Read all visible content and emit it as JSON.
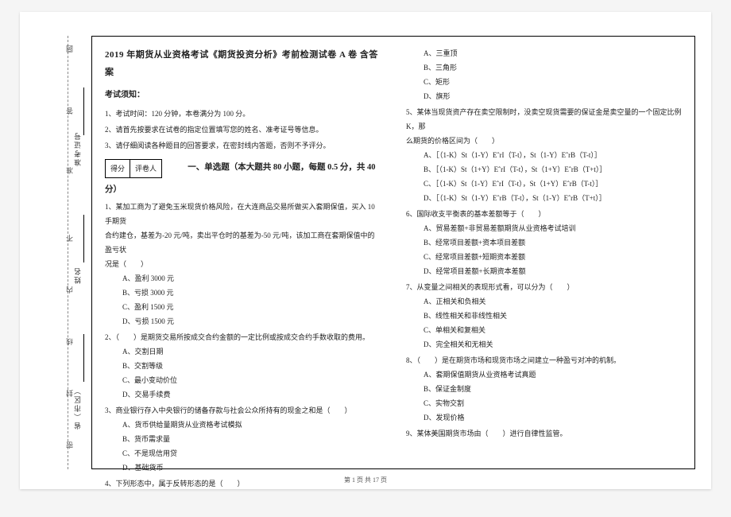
{
  "doc": {
    "title": "2019 年期货从业资格考试《期货投资分析》考前检测试卷 A 卷  含答案",
    "notice_head": "考试须知：",
    "instructions": [
      "1、考试时间：120 分钟，本卷满分为 100 分。",
      "2、请首先按要求在试卷的指定位置填写您的姓名、准考证号等信息。",
      "3、请仔细阅读各种题目的回答要求，在密封线内答题，否则不予评分。"
    ],
    "score_labels": {
      "a": "得分",
      "b": "评卷人"
    },
    "section1_title": "一、单选题（本大题共 80 小题，每题 0.5 分，共 40 分）",
    "q1": {
      "stem1": "1、某加工商为了避免玉米现货价格风险，在大连商品交易所做买入套期保值，买入 10 手期货",
      "stem2": "合约建仓，基差为-20 元/吨，卖出平仓时的基差为-50 元/吨，该加工商在套期保值中的盈亏状",
      "stem3": "况是（　　）",
      "opts": [
        "A、盈利 3000 元",
        "B、亏损 3000 元",
        "C、盈利 1500 元",
        "D、亏损 1500 元"
      ]
    },
    "q2": {
      "stem": "2、（　　）是期货交易所按成交合约金额的一定比例或按成交合约手数收取的费用。",
      "opts": [
        "A、交割日期",
        "B、交割等级",
        "C、最小变动价位",
        "D、交易手续费"
      ]
    },
    "q3": {
      "stem": "3、商业银行存入中央银行的储备存款与社会公众所持有的现金之和是（　　）",
      "opts": [
        "A、货币供给量期货从业资格考试模拟",
        "B、货币需求量",
        "C、不是现信用贷",
        "D、基础货币"
      ]
    },
    "q4": {
      "stem": "4、下列形态中，属于反转形态的是（　　）",
      "opts": [
        "A、三重顶",
        "B、三角形",
        "C、矩形",
        "D、旗形"
      ]
    },
    "q5": {
      "stem1": "5、某体当现货资产存在卖空限制时，没卖空现货需要的保证金是卖空量的一个固定比例 K，那",
      "stem2": "么期货的价格区间为（　　）",
      "opts": [
        "A、［（1-K）St（1-Y）EˆrI（T-t），St（1-Y）EˆrB（T-t）］",
        "B、［（1-K）St（1+Y）EˆrI（T-t），St（1+Y）EˆrB（T+t）］",
        "C、［（1-K）St（1-Y）EˆrI（T-t），St（1+Y）EˆrB（T-t）］",
        "D、［（1-K）St（1-Y）EˆrB（T-t），St（1-Y）EˆrB（T+t）］"
      ]
    },
    "q6": {
      "stem": "6、国际收支平衡表的基本差额等于（　　）",
      "opts": [
        "A、贸易差额+非贸易差额期货从业资格考试培训",
        "B、经常项目差额+资本项目差额",
        "C、经常项目差额+短期资本差额",
        "D、经常项目差额+长期资本差额"
      ]
    },
    "q7": {
      "stem": "7、从变量之间相关的表现形式看，可以分为（　　）",
      "opts": [
        "A、正相关和负相关",
        "B、线性相关和非线性相关",
        "C、单相关和复相关",
        "D、完全相关和无相关"
      ]
    },
    "q8": {
      "stem": "8、（　　）是在期货市场和现货市场之间建立一种盈亏对冲的机制。",
      "opts": [
        "A、套期保值期货从业资格考试真题",
        "B、保证金制度",
        "C、实物交割",
        "D、发现价格"
      ]
    },
    "q9": {
      "stem": "9、某体美国期货市场由（　　）进行自律性监管。"
    },
    "footer": "第 1 页 共 17 页",
    "gutter": {
      "chars": [
        "圆",
        "答",
        "准",
        "不",
        "内",
        "线",
        "封",
        "密"
      ],
      "fields": [
        "准考证号",
        "姓名",
        "省（市区）"
      ]
    }
  }
}
